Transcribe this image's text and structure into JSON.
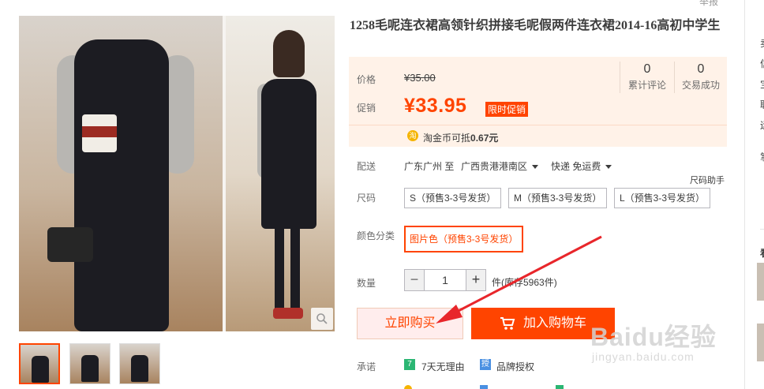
{
  "title": "1258毛呢连衣裙高领针织拼接毛呢假两件连衣裙2014-16高初中学生",
  "report_label": "举报",
  "price": {
    "price_label": "价格",
    "original_price": "¥35.00",
    "promo_label": "促销",
    "promo_price": "¥33.95",
    "promo_tag": "限时促销",
    "review_count": "0",
    "review_label": "累计评论",
    "deal_count": "0",
    "deal_label": "交易成功",
    "coin_icon": "淘",
    "coin_text": "淘金币可抵",
    "coin_amount": "0.67元"
  },
  "delivery": {
    "label": "配送",
    "from": "广东广州 至",
    "to": "广西贵港港南区",
    "method": "快递 免运费"
  },
  "size": {
    "helper": "尺码助手",
    "label": "尺码",
    "options": [
      "S（预售3-3号发货）",
      "M（预售3-3号发货）",
      "L（预售3-3号发货）"
    ]
  },
  "color": {
    "label": "颜色分类",
    "selected": "图片色（预售3-3号发货）"
  },
  "quantity": {
    "label": "数量",
    "minus": "−",
    "value": "1",
    "plus": "+",
    "stock": "件(库存5963件)"
  },
  "actions": {
    "buy_now": "立即购买",
    "add_to_cart": "加入购物车"
  },
  "promises": {
    "label": "承诺",
    "items": [
      {
        "icon": "7",
        "text": "7天无理由",
        "color": "#2bb673"
      },
      {
        "icon": "授",
        "text": "品牌授权",
        "color": "#4a90e2"
      }
    ]
  },
  "sidebar": {
    "glyphs": [
      "卖",
      "信",
      "宝",
      "联",
      "运",
      "掌",
      "看"
    ]
  },
  "watermark": {
    "main": "Baidu经验",
    "sub": "jingyan.baidu.com"
  },
  "colors": {
    "accent": "#ff4400",
    "price_bg": "#fff2e8"
  }
}
